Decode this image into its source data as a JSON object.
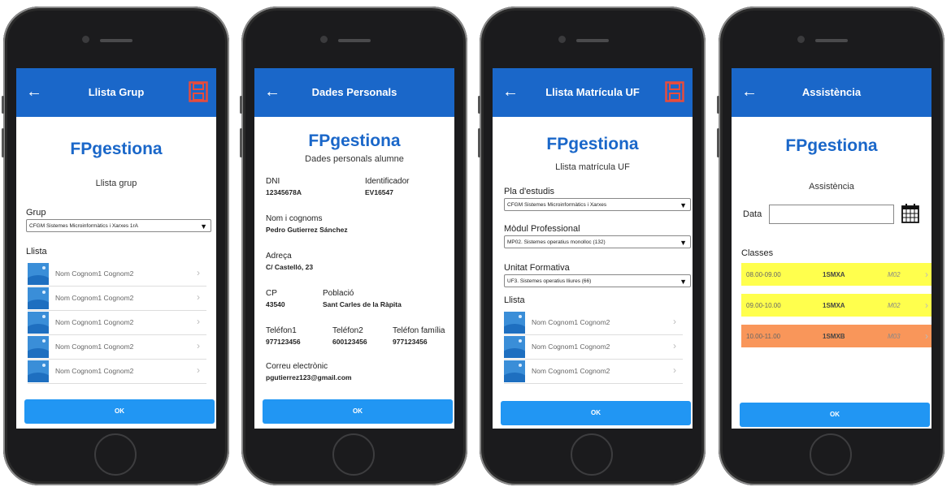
{
  "colors": {
    "primary": "#1a67c9",
    "ok_button": "#2196f3",
    "save_icon": "#e74c3c",
    "class_yellow": "#ffff4d",
    "class_orange": "#f9965a"
  },
  "common": {
    "brand": "FPgestiona",
    "ok_label": "OK",
    "back_icon": "arrow-left-icon",
    "list_item_name": "Nom Cognom1 Cognom2"
  },
  "screen1": {
    "title": "Llista Grup",
    "subtitle": "Llista grup",
    "group_label": "Grup",
    "group_value": "CFGM Sistemes Microinformàtics i Xarxes 1rA",
    "list_label": "Llista",
    "students": [
      "Nom Cognom1 Cognom2",
      "Nom Cognom1 Cognom2",
      "Nom Cognom1 Cognom2",
      "Nom Cognom1 Cognom2",
      "Nom Cognom1 Cognom2"
    ]
  },
  "screen2": {
    "title": "Dades Personals",
    "subtitle": "Dades personals alumne",
    "dni_label": "DNI",
    "dni_value": "12345678A",
    "id_label": "Identificador",
    "id_value": "EV16547",
    "name_label": "Nom i cognoms",
    "name_value": "Pedro Gutierrez Sánchez",
    "address_label": "Adreça",
    "address_value": "C/ Castelló, 23",
    "cp_label": "CP",
    "cp_value": "43540",
    "town_label": "Població",
    "town_value": "Sant Carles de la Ràpita",
    "phone1_label": "Teléfon1",
    "phone1_value": "977123456",
    "phone2_label": "Teléfon2",
    "phone2_value": "600123456",
    "phone_family_label": "Teléfon família",
    "phone_family_value": "977123456",
    "email_label": "Correu electrònic",
    "email_value": "pgutierrez123@gmail.com"
  },
  "screen3": {
    "title": "Llista Matrícula UF",
    "subtitle": "Llista matrícula UF",
    "plan_label": "Pla d'estudis",
    "plan_value": "CFGM Sistemes Microinformàtics i Xarxes",
    "module_label": "Mòdul Professional",
    "module_value": "MP02. Sistemes operatius monolloc (132)",
    "unit_label": "Unitat Formativa",
    "unit_value": "UF3. Sistemes operatius lliures (66)",
    "list_label": "Llista",
    "students": [
      "Nom Cognom1 Cognom2",
      "Nom Cognom1 Cognom2",
      "Nom Cognom1 Cognom2"
    ]
  },
  "screen4": {
    "title": "Assistència",
    "subtitle": "Assistència",
    "date_label": "Data",
    "date_value": "",
    "classes_label": "Classes",
    "classes": [
      {
        "time": "08.00-09.00",
        "group": "1SMXA",
        "module": "M02",
        "color": "#ffff4d"
      },
      {
        "time": "09.00-10.00",
        "group": "1SMXA",
        "module": "M02",
        "color": "#ffff4d"
      },
      {
        "time": "10.00-11.00",
        "group": "1SMXB",
        "module": "M03",
        "color": "#f9965a"
      }
    ]
  }
}
